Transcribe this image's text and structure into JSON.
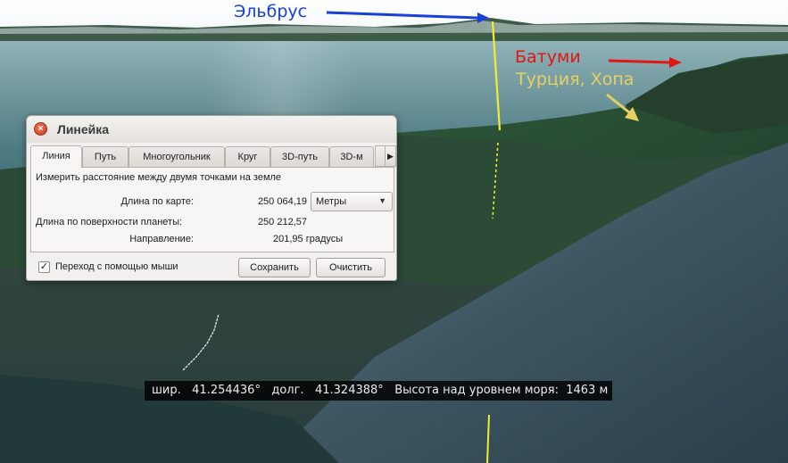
{
  "annotations": {
    "elbrus": "Эльбрус",
    "batumi": "Батуми",
    "turkey": "Турция, Хопа",
    "colors": {
      "elbrus": "#1640d8",
      "batumi": "#e01515",
      "turkey": "#e8d060",
      "ruler_line": "#f2ec2e"
    }
  },
  "ruler": {
    "title": "Линейка",
    "close_icon": "close-icon",
    "tabs": [
      "Линия",
      "Путь",
      "Многоугольник",
      "Круг",
      "3D-путь",
      "3D-м"
    ],
    "active_tab": "Линия",
    "tab_scroll_icon": "chevron-right-icon",
    "description": "Измерить расстояние между двумя точками на земле",
    "map_length_label": "Длина по карте:",
    "map_length_value": "250 064,19",
    "unit_selected": "Метры",
    "surface_length_label": "Длина по поверхности планеты:",
    "surface_length_value": "250 212,57",
    "direction_label": "Направление:",
    "direction_value": "201,95 градусы",
    "mouse_nav_label": "Переход с помощью мыши",
    "mouse_nav_checked": true,
    "save_button": "Сохранить",
    "clear_button": "Очистить"
  },
  "status": {
    "lat_label": "шир.",
    "lat_value": "41.254436°",
    "lon_label": "долг.",
    "lon_value": "41.324388°",
    "alt_label": "Высота над уровнем моря:",
    "alt_value": "1463 м"
  }
}
